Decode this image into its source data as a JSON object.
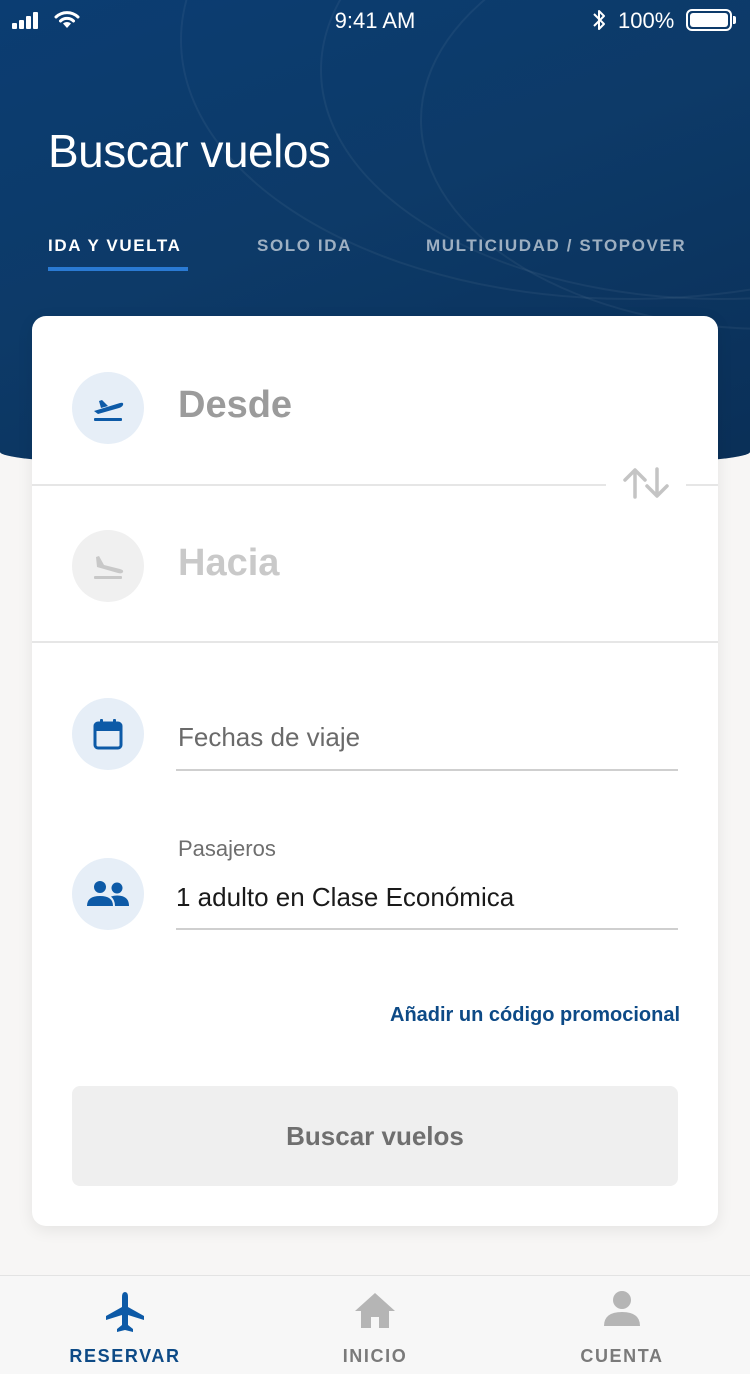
{
  "status_bar": {
    "time": "9:41 AM",
    "battery": "100%"
  },
  "header": {
    "title": "Buscar vuelos",
    "tabs": [
      {
        "label": "IDA Y VUELTA",
        "active": true
      },
      {
        "label": "SOLO IDA",
        "active": false
      },
      {
        "label": "MULTICIUDAD / STOPOVER",
        "active": false
      }
    ]
  },
  "form": {
    "from_placeholder": "Desde",
    "to_placeholder": "Hacia",
    "dates_placeholder": "Fechas de viaje",
    "passengers_label": "Pasajeros",
    "passengers_value": "1 adulto en Clase Económica",
    "promo_link": "Añadir un código promocional",
    "search_button": "Buscar vuelos"
  },
  "bottom_nav": [
    {
      "label": "RESERVAR",
      "icon": "airplane-icon",
      "active": true
    },
    {
      "label": "INICIO",
      "icon": "home-icon",
      "active": false
    },
    {
      "label": "CUENTA",
      "icon": "user-icon",
      "active": false
    }
  ],
  "colors": {
    "header_bg": "#0b3d72",
    "accent": "#0d4a86",
    "tab_underline": "#2a7ad3"
  }
}
